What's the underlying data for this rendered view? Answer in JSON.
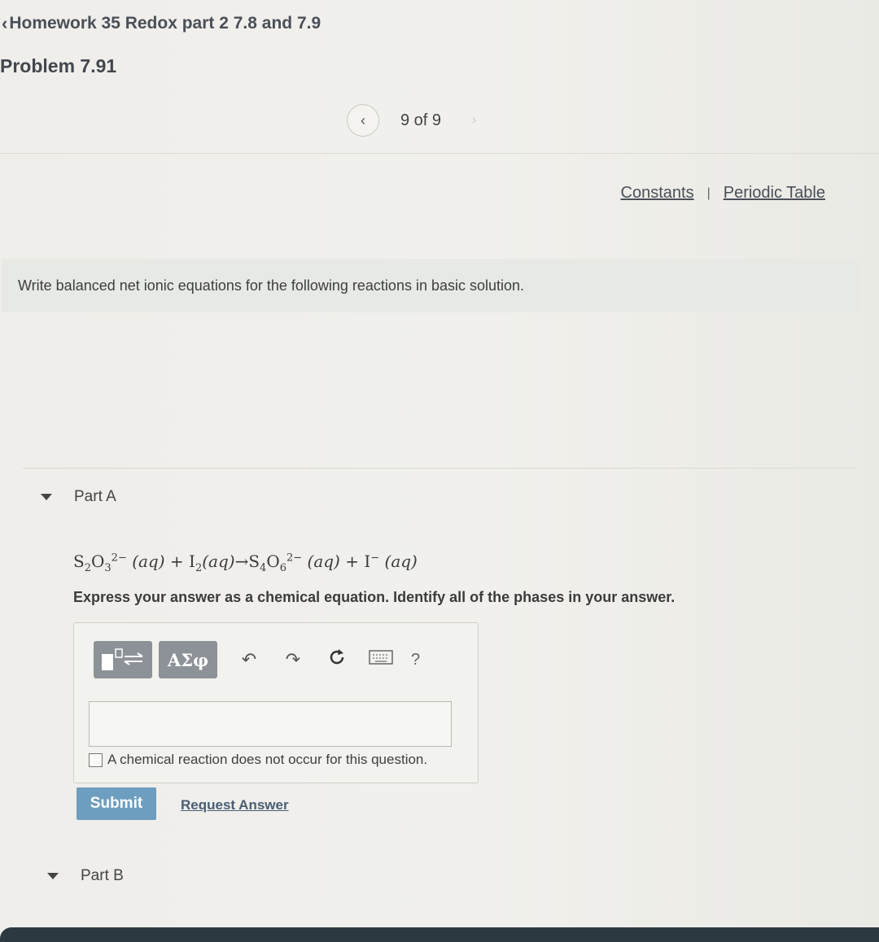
{
  "header": {
    "back_link": "Homework 35 Redox part 2 7.8 and 7.9",
    "problem_title": "Problem 7.91"
  },
  "pager": {
    "position": "9 of 9"
  },
  "resources": {
    "constants": "Constants",
    "separator": "|",
    "periodic_table": "Periodic Table"
  },
  "intro": "Write balanced net ionic equations for the following reactions in basic solution.",
  "partA": {
    "label": "Part A",
    "equation": {
      "r1": "S",
      "r1_sub1": "2",
      "r1_o": "O",
      "r1_sub2": "3",
      "r1_charge": "2−",
      "aq": "(aq)",
      "plus": "+",
      "r2": "I",
      "r2_sub": "2",
      "arrow": "→",
      "p1": "S",
      "p1_sub1": "4",
      "p1_o": "O",
      "p1_sub2": "6",
      "p1_charge": "2−",
      "p2": "I",
      "p2_charge": "−"
    },
    "instructions": "Express your answer as a chemical equation. Identify all of the phases in your answer.",
    "toolbar": {
      "greek_label": "ΑΣφ",
      "help_label": "?"
    },
    "no_reaction_label": "A chemical reaction does not occur for this question.",
    "submit_label": "Submit",
    "request_label": "Request Answer"
  },
  "partB": {
    "label": "Part B"
  },
  "colors": {
    "submit": "#6e9ebf",
    "toolbar_button": "#8d9198",
    "intro_background": "#e7eae4"
  }
}
